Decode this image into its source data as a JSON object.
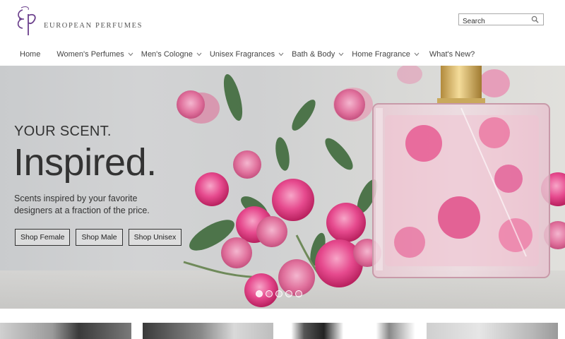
{
  "brand": {
    "name": "EUROPEAN PERFUMES",
    "accent": "#6b3f8c"
  },
  "search": {
    "placeholder": "Search",
    "icon": "search-icon"
  },
  "nav": {
    "items": [
      {
        "label": "Home",
        "dropdown": false
      },
      {
        "label": "Women's Perfumes",
        "dropdown": true
      },
      {
        "label": "Men's Cologne",
        "dropdown": true
      },
      {
        "label": "Unisex Fragrances",
        "dropdown": true
      },
      {
        "label": "Bath & Body",
        "dropdown": true
      },
      {
        "label": "Home Fragrance",
        "dropdown": true
      },
      {
        "label": "What's New?",
        "dropdown": false
      }
    ]
  },
  "hero": {
    "kicker": "YOUR SCENT.",
    "title": "Inspired.",
    "subtitle": "Scents inspired by your favorite designers at a fraction of the price.",
    "buttons": [
      {
        "label": "Shop Female"
      },
      {
        "label": "Shop Male"
      },
      {
        "label": "Shop Unisex"
      }
    ],
    "slides": 5,
    "active_slide": 1
  }
}
